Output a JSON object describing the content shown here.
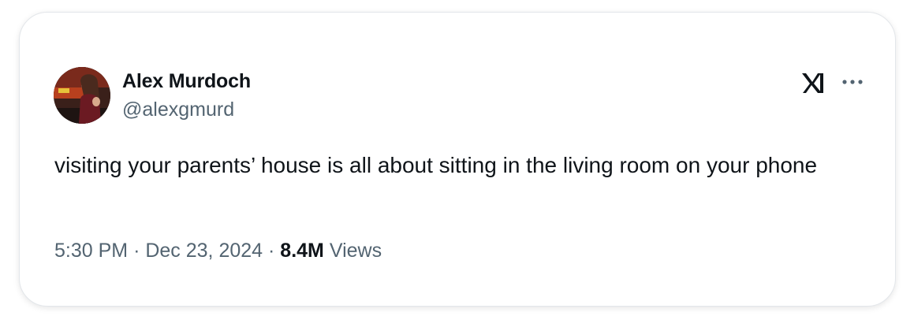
{
  "author": {
    "display_name": "Alex Murdoch",
    "handle": "@alexgmurd",
    "avatar_icon": "profile-photo"
  },
  "header_icons": {
    "platform_icon": "x-logo-icon",
    "menu_icon": "more-options-icon"
  },
  "tweet": {
    "text": "visiting your parents’ house is all about sitting in the living room on your phone"
  },
  "meta": {
    "time": "5:30 PM",
    "separator": "·",
    "date": "Dec 23, 2024",
    "views_count": "8.4M",
    "views_label": "Views"
  },
  "colors": {
    "text_primary": "#0f1419",
    "text_secondary": "#536471",
    "card_border": "#e3e6ea",
    "background": "#ffffff"
  }
}
